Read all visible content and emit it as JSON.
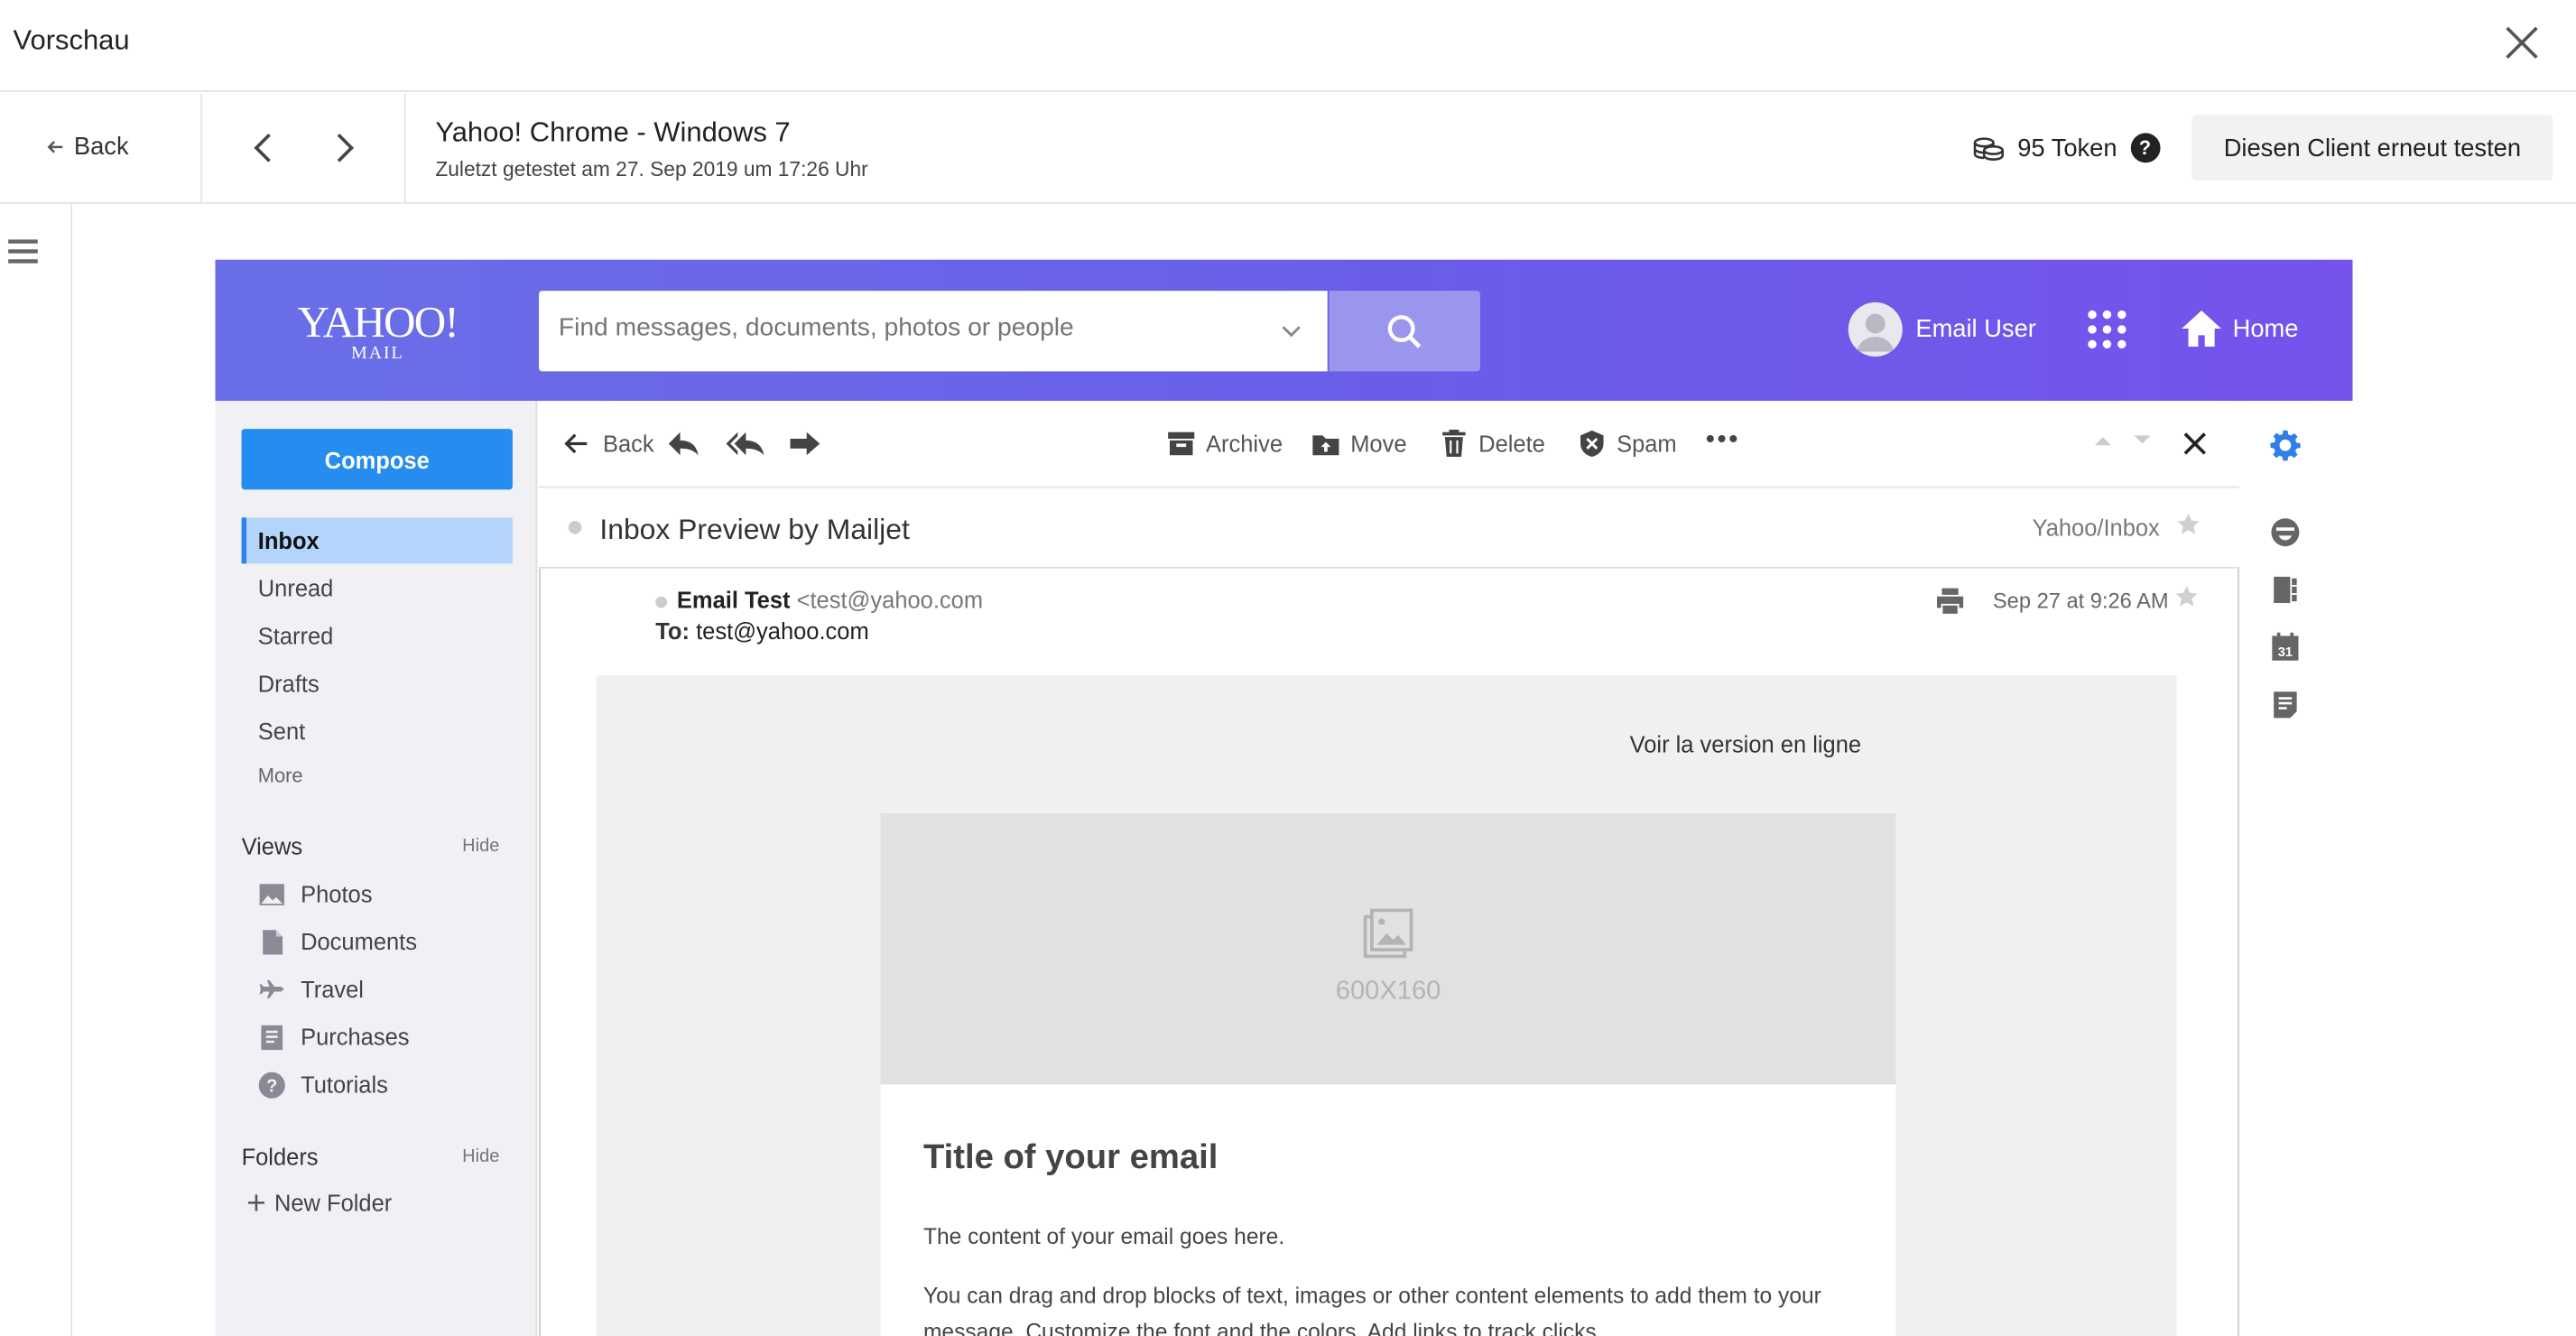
{
  "preview": {
    "title": "Vorschau",
    "back_label": "Back",
    "client_name": "Yahoo! Chrome - Windows 7",
    "tested_at": "Zuletzt getestet am 27. Sep 2019 um 17:26 Uhr",
    "tokens": "95 Token",
    "help": "?",
    "retest_label": "Diesen Client erneut testen"
  },
  "yahoo": {
    "logo_line1": "YAHOO!",
    "logo_line2": "MAIL",
    "search_placeholder": "Find messages, documents, photos or people",
    "user_name": "Email User",
    "home_label": "Home",
    "compose_label": "Compose",
    "folders": [
      "Inbox",
      "Unread",
      "Starred",
      "Drafts",
      "Sent"
    ],
    "more_label": "More",
    "views_title": "Views",
    "folders_title": "Folders",
    "hide_label": "Hide",
    "views": [
      "Photos",
      "Documents",
      "Travel",
      "Purchases",
      "Tutorials"
    ],
    "new_folder_label": "New Folder",
    "toolbar": {
      "back": "Back",
      "archive": "Archive",
      "move": "Move",
      "delete": "Delete",
      "spam": "Spam"
    },
    "subject": "Inbox Preview by Mailjet",
    "folder_path": "Yahoo/Inbox",
    "sender_name": "Email Test",
    "sender_email": "<test@yahoo.com",
    "to_label": "To:",
    "to_address": "test@yahoo.com",
    "date": "Sep 27 at 9:26 AM"
  },
  "email": {
    "view_online": "Voir la version en ligne",
    "image_label": "600X160",
    "title": "Title of your email",
    "p1": "The content of your email goes here.",
    "p2": "You can drag and drop blocks of text, images or other content elements to add them to your message. Customize the font and the colors. Add links to track clicks."
  },
  "colors": {
    "header_gradient_start": "#6a6fe8",
    "header_gradient_end": "#7553ec",
    "compose_blue": "#258cf0",
    "active_folder": "#b3d5fb"
  }
}
